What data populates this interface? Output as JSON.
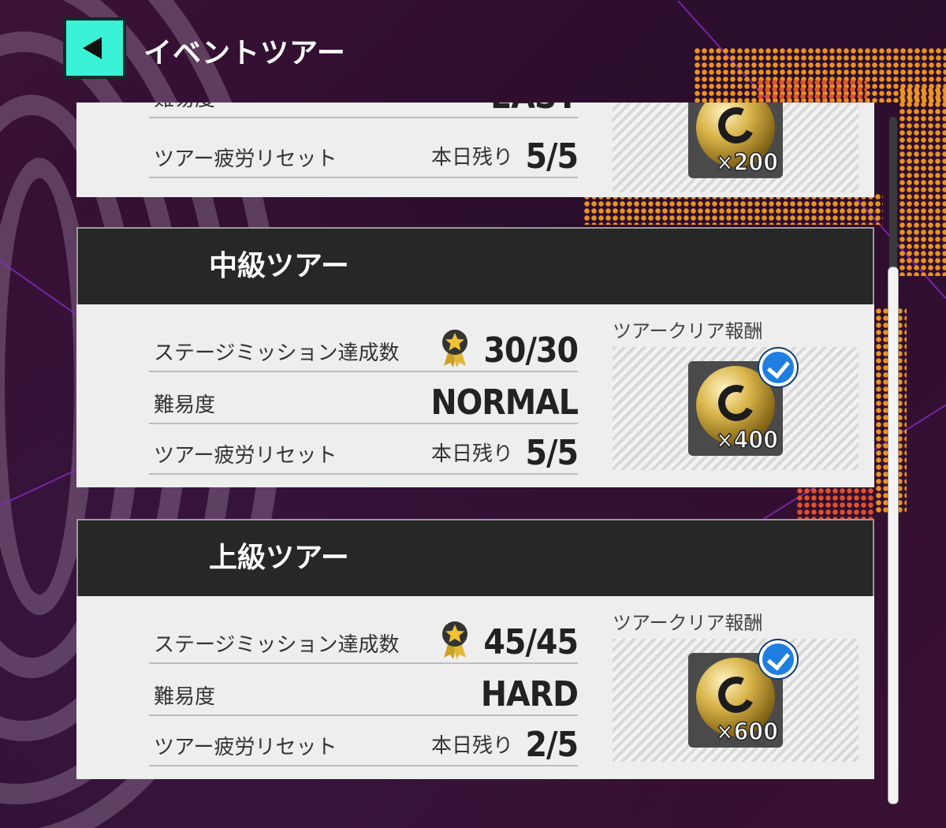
{
  "header": {
    "title": "イベントツアー"
  },
  "colors": {
    "accent": "#3af2d6",
    "card_header_bg": "#272727",
    "check_blue": "#1f7fe0"
  },
  "cards": {
    "easy": {
      "difficulty_label": "難易度",
      "difficulty_value": "EASY",
      "reset_label": "ツアー疲労リセット",
      "reset_sub": "本日残り",
      "reset_value": "5/5",
      "reward_qty": "×200",
      "reward_icon": "gold-ball-icon"
    },
    "intermediate": {
      "title": "中級ツアー",
      "mission_label": "ステージミッション達成数",
      "mission_value": "30/30",
      "difficulty_label": "難易度",
      "difficulty_value": "NORMAL",
      "reset_label": "ツアー疲労リセット",
      "reset_sub": "本日残り",
      "reset_value": "5/5",
      "reward_label": "ツアークリア報酬",
      "reward_qty": "×400",
      "reward_claimed": true
    },
    "advanced": {
      "title": "上級ツアー",
      "mission_label": "ステージミッション達成数",
      "mission_value": "45/45",
      "difficulty_label": "難易度",
      "difficulty_value": "HARD",
      "reset_label": "ツアー疲労リセット",
      "reset_sub": "本日残り",
      "reset_value": "2/5",
      "reward_label": "ツアークリア報酬",
      "reward_qty": "×600",
      "reward_claimed": true
    }
  }
}
